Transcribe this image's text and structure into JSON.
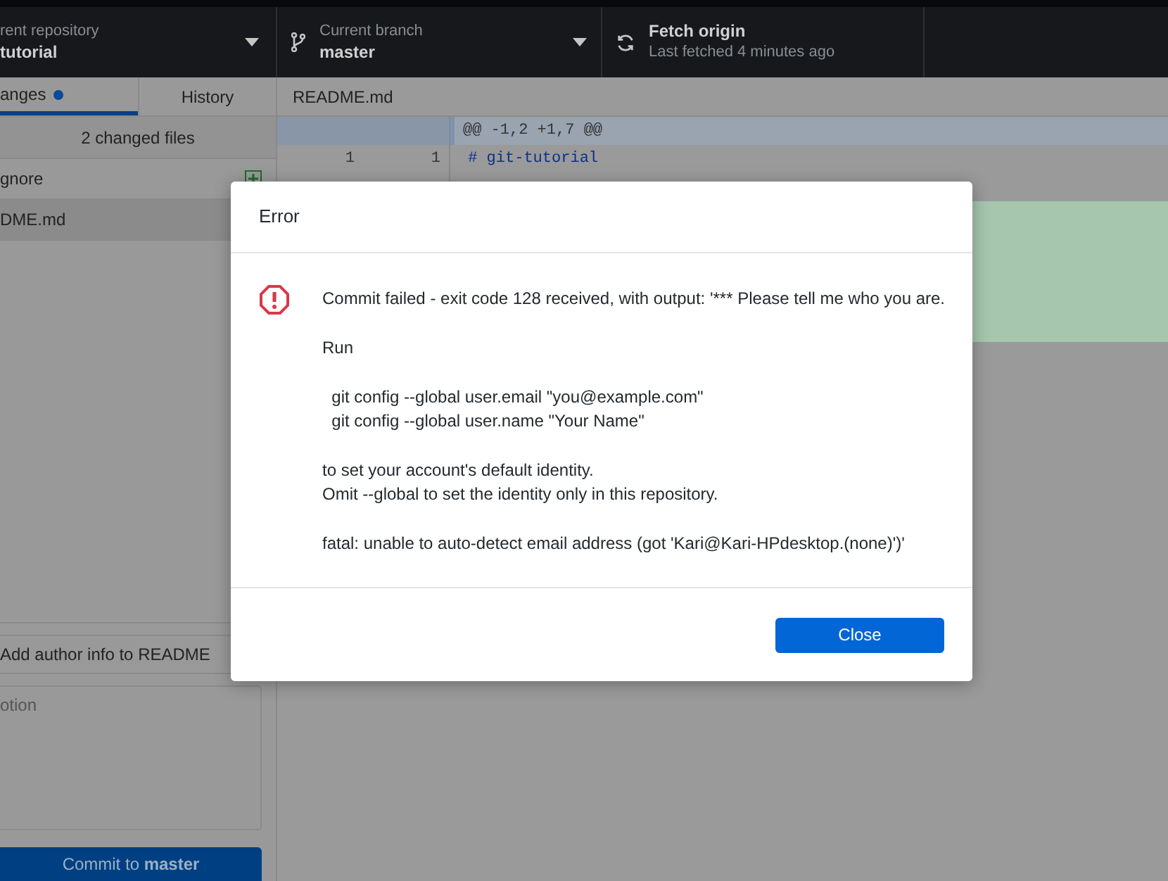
{
  "toolbar": {
    "repository": {
      "label": "rent repository",
      "value": "tutorial"
    },
    "branch": {
      "label": "Current branch",
      "value": "master"
    },
    "fetch": {
      "title": "Fetch origin",
      "subtitle": "Last fetched 4 minutes ago"
    }
  },
  "sidebar": {
    "tabs": [
      {
        "label": "anges",
        "selected": true,
        "has_changes": true
      },
      {
        "label": "History",
        "selected": false,
        "has_changes": false
      }
    ],
    "changed_files": "2 changed files",
    "files": [
      {
        "name": "gnore",
        "selected": false,
        "kind": "added"
      },
      {
        "name": "DME.md",
        "selected": true
      }
    ],
    "commit": {
      "summary": "Add author info to README",
      "description_placeholder": "otion",
      "button": "Commit to **master**"
    }
  },
  "diff": {
    "file": "README.md",
    "hunk": "@@ -1,2 +1,7 @@",
    "lines": [
      {
        "kind": "context",
        "old": "1",
        "new": "1",
        "text": " # git-tutorial"
      },
      {
        "kind": "context"
      },
      {
        "kind": "added"
      },
      {
        "kind": "added"
      },
      {
        "kind": "added"
      },
      {
        "kind": "added"
      },
      {
        "kind": "added"
      }
    ]
  },
  "dialog": {
    "title": "Error",
    "paragraphs": [
      [
        "Commit failed - exit code 128 received, with output: '*** Please tell me who you are."
      ],
      [
        "Run"
      ],
      [
        "  git config --global user.email \"you@example.com\"",
        "  git config --global user.name \"Your Name\""
      ],
      [
        "to set your account's default identity.",
        "Omit --global to set the identity only in this repository."
      ],
      [
        "fatal: unable to auto-detect email address (got 'Kari@Kari-HPdesktop.(none)')'"
      ]
    ],
    "button": "Close"
  }
}
